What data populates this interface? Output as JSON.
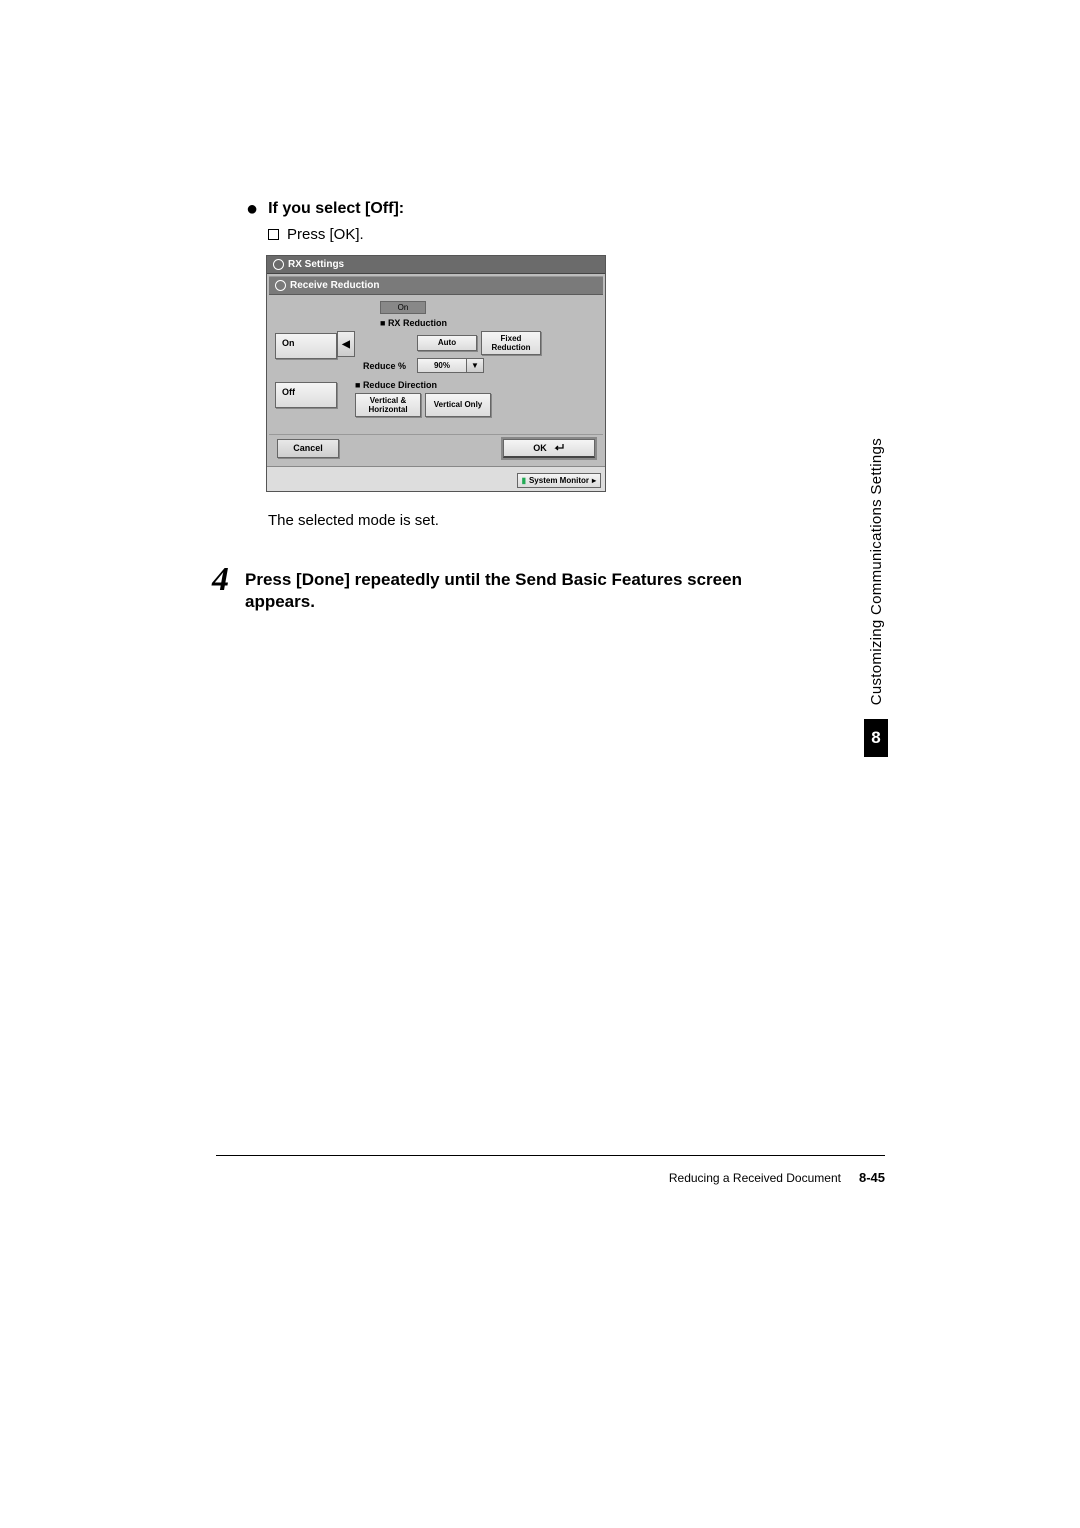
{
  "bullet_heading": "If you select [Off]:",
  "sub_instruction": "Press [OK].",
  "screenshot": {
    "title_main": "RX Settings",
    "title_sub": "Receive Reduction",
    "state_label": "On",
    "section_rx": "RX Reduction",
    "btn_on": "On",
    "btn_off": "Off",
    "btn_auto": "Auto",
    "btn_fixed": "Fixed Reduction",
    "label_reduce_pct": "Reduce %",
    "val_reduce_pct": "90%",
    "section_dir": "Reduce Direction",
    "btn_dir_both": "Vertical & Horizontal",
    "btn_dir_vert": "Vertical  Only",
    "btn_cancel": "Cancel",
    "btn_ok": "OK",
    "btn_sysmon": "System Monitor"
  },
  "result_text": "The selected mode is set.",
  "step_number": "4",
  "step_text": "Press [Done] repeatedly until the Send Basic Features screen appears.",
  "side_label": "Customizing Communications Settings",
  "side_chapter": "8",
  "footer_title": "Reducing a Received Document",
  "footer_page": "8-45"
}
